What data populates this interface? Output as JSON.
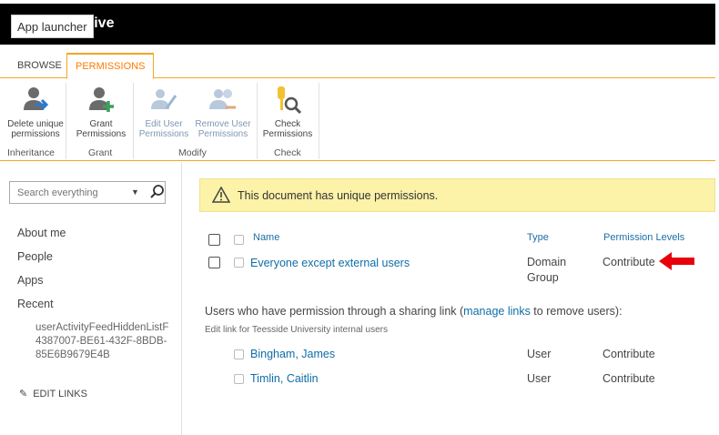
{
  "suite": {
    "title_fragment": "rive",
    "app_launcher_tooltip": "App launcher"
  },
  "ribbon": {
    "tabs": [
      {
        "label": "BROWSE"
      },
      {
        "label": "PERMISSIONS"
      }
    ],
    "buttons": {
      "delete_unique": [
        "Delete unique",
        "permissions"
      ],
      "grant": [
        "Grant",
        "Permissions"
      ],
      "edit_user": [
        "Edit User",
        "Permissions"
      ],
      "remove_user": [
        "Remove User",
        "Permissions"
      ],
      "check": [
        "Check",
        "Permissions"
      ]
    },
    "groups": {
      "inheritance": "Inheritance",
      "grant": "Grant",
      "modify": "Modify",
      "check": "Check"
    }
  },
  "leftnav": {
    "search_placeholder": "Search everything",
    "items": [
      "About me",
      "People",
      "Apps",
      "Recent"
    ],
    "recent_item": "userActivityFeedHiddenListF4387007-BE61-432F-8BDB-85E6B9679E4B",
    "edit_links": "EDIT LINKS"
  },
  "main": {
    "banner": "This document has unique permissions.",
    "headers": {
      "name": "Name",
      "type": "Type",
      "levels": "Permission Levels"
    },
    "rows": [
      {
        "name": "Everyone except external users",
        "type_line1": "Domain",
        "type_line2": "Group",
        "level": "Contribute"
      }
    ],
    "sharing": {
      "before": "Users who have permission through a sharing link (",
      "link": "manage links",
      "after": " to remove users):",
      "sublabel": "Edit link for Teesside University internal users"
    },
    "sharing_users": [
      {
        "name": "Bingham, James",
        "type": "User",
        "level": "Contribute"
      },
      {
        "name": "Timlin, Caitlin",
        "type": "User",
        "level": "Contribute"
      }
    ]
  },
  "colors": {
    "accent": "#f5a623",
    "link": "#0f6da8",
    "banner_bg": "#fcf2a8",
    "arrow": "#e8000b"
  }
}
